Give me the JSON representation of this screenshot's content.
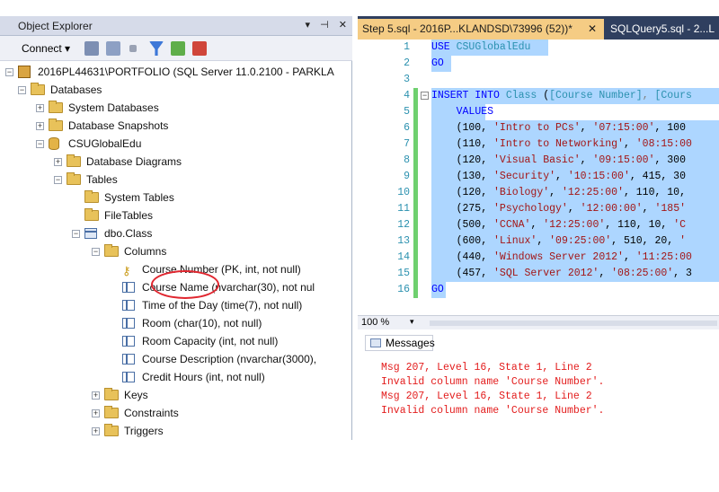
{
  "object_explorer": {
    "title": "Object Explorer",
    "title_buttons": [
      "▾",
      "⊣",
      "✕"
    ],
    "toolbar": {
      "connect_label": "Connect ▾"
    },
    "tree": [
      {
        "label": "2016PL44631\\PORTFOLIO (SQL Server 11.0.2100 - PARKLA",
        "icon": "server-icon",
        "expander": "-"
      },
      {
        "label": "Databases",
        "icon": "folder-icon",
        "expander": "-"
      },
      {
        "label": "System Databases",
        "icon": "folder-icon",
        "expander": "+"
      },
      {
        "label": "Database Snapshots",
        "icon": "folder-icon",
        "expander": "+"
      },
      {
        "label": "CSUGlobalEdu",
        "icon": "database-icon",
        "expander": "-"
      },
      {
        "label": "Database Diagrams",
        "icon": "folder-icon",
        "expander": "+"
      },
      {
        "label": "Tables",
        "icon": "folder-icon",
        "expander": "-"
      },
      {
        "label": "System Tables",
        "icon": "folder-icon",
        "expander": ""
      },
      {
        "label": "FileTables",
        "icon": "folder-icon",
        "expander": ""
      },
      {
        "label": "dbo.Class",
        "icon": "table-icon",
        "expander": "-"
      },
      {
        "label": "Columns",
        "icon": "folder-icon",
        "expander": "-"
      },
      {
        "label": "Course Number (PK, int, not null)",
        "icon": "key-icon",
        "expander": ""
      },
      {
        "label": "Course Name (nvarchar(30), not nul",
        "icon": "column-icon",
        "expander": ""
      },
      {
        "label": "Time of the Day (time(7), not null)",
        "icon": "column-icon",
        "expander": ""
      },
      {
        "label": "Room (char(10), not null)",
        "icon": "column-icon",
        "expander": ""
      },
      {
        "label": "Room Capacity (int, not null)",
        "icon": "column-icon",
        "expander": ""
      },
      {
        "label": "Course Description (nvarchar(3000),",
        "icon": "column-icon",
        "expander": ""
      },
      {
        "label": "Credit Hours (int, not null)",
        "icon": "column-icon",
        "expander": ""
      },
      {
        "label": "Keys",
        "icon": "folder-icon",
        "expander": "+"
      },
      {
        "label": "Constraints",
        "icon": "folder-icon",
        "expander": "+"
      },
      {
        "label": "Triggers",
        "icon": "folder-icon",
        "expander": "+"
      }
    ]
  },
  "editor": {
    "tabs": [
      {
        "label": "Step 5.sql - 2016P...KLANDSD\\73996 (52))*",
        "close": "✕",
        "active": true
      },
      {
        "label": "SQLQuery5.sql - 2...L",
        "active": false
      }
    ],
    "code_lines": [
      {
        "n": "1",
        "parts": [
          [
            "kw",
            "USE"
          ],
          [
            "",
            " "
          ],
          [
            "tbl",
            "CSUGlobalEdu"
          ]
        ]
      },
      {
        "n": "2",
        "parts": [
          [
            "kw",
            "GO"
          ]
        ]
      },
      {
        "n": "3",
        "parts": []
      },
      {
        "n": "4",
        "parts": [
          [
            "kw",
            "INSERT INTO"
          ],
          [
            "",
            " "
          ],
          [
            "tbl",
            "Class"
          ],
          [
            "",
            " ("
          ],
          [
            "tbl",
            "[Course Number]"
          ],
          [
            "gr",
            ", "
          ],
          [
            "tbl",
            "[Cours"
          ]
        ]
      },
      {
        "n": "5",
        "parts": [
          [
            "",
            "    "
          ],
          [
            "kw",
            "VALUES"
          ]
        ]
      },
      {
        "n": "6",
        "parts": [
          [
            "",
            "    (100, "
          ],
          [
            "str",
            "'Intro to PCs'"
          ],
          [
            "",
            ", "
          ],
          [
            "str",
            "'07:15:00'"
          ],
          [
            "",
            ", 100"
          ]
        ]
      },
      {
        "n": "7",
        "parts": [
          [
            "",
            "    (110, "
          ],
          [
            "str",
            "'Intro to Networking'"
          ],
          [
            "",
            ", "
          ],
          [
            "str",
            "'08:15:00"
          ]
        ]
      },
      {
        "n": "8",
        "parts": [
          [
            "",
            "    (120, "
          ],
          [
            "str",
            "'Visual Basic'"
          ],
          [
            "",
            ", "
          ],
          [
            "str",
            "'09:15:00'"
          ],
          [
            "",
            ", 300"
          ]
        ]
      },
      {
        "n": "9",
        "parts": [
          [
            "",
            "    (130, "
          ],
          [
            "str",
            "'Security'"
          ],
          [
            "",
            ", "
          ],
          [
            "str",
            "'10:15:00'"
          ],
          [
            "",
            ", 415, 30"
          ]
        ]
      },
      {
        "n": "10",
        "parts": [
          [
            "",
            "    (120, "
          ],
          [
            "str",
            "'Biology'"
          ],
          [
            "",
            ", "
          ],
          [
            "str",
            "'12:25:00'"
          ],
          [
            "",
            ", 110, 10,"
          ]
        ]
      },
      {
        "n": "11",
        "parts": [
          [
            "",
            "    (275, "
          ],
          [
            "str",
            "'Psychology'"
          ],
          [
            "",
            ", "
          ],
          [
            "str",
            "'12:00:00'"
          ],
          [
            "",
            ", "
          ],
          [
            "str",
            "'185'"
          ]
        ]
      },
      {
        "n": "12",
        "parts": [
          [
            "",
            "    (500, "
          ],
          [
            "str",
            "'CCNA'"
          ],
          [
            "",
            ", "
          ],
          [
            "str",
            "'12:25:00'"
          ],
          [
            "",
            ", 110, 10, "
          ],
          [
            "str",
            "'C"
          ]
        ]
      },
      {
        "n": "13",
        "parts": [
          [
            "",
            "    (600, "
          ],
          [
            "str",
            "'Linux'"
          ],
          [
            "",
            ", "
          ],
          [
            "str",
            "'09:25:00'"
          ],
          [
            "",
            ", 510, 20, "
          ],
          [
            "str",
            "'"
          ]
        ]
      },
      {
        "n": "14",
        "parts": [
          [
            "",
            "    (440, "
          ],
          [
            "str",
            "'Windows Server 2012'"
          ],
          [
            "",
            ", "
          ],
          [
            "str",
            "'11:25:00"
          ]
        ]
      },
      {
        "n": "15",
        "parts": [
          [
            "",
            "    (457, "
          ],
          [
            "str",
            "'SQL Server 2012'"
          ],
          [
            "",
            ", "
          ],
          [
            "str",
            "'08:25:00'"
          ],
          [
            "",
            ", 3"
          ]
        ]
      },
      {
        "n": "16",
        "parts": [
          [
            "kw",
            "GO"
          ]
        ]
      }
    ],
    "zoom": "100 %",
    "zoom_dropdown": "▾"
  },
  "results": {
    "tab_label": "Messages",
    "messages": [
      "Msg 207, Level 16, State 1, Line 2",
      "Invalid column name 'Course Number'.",
      "Msg 207, Level 16, State 1, Line 2",
      "Invalid column name 'Course Number'."
    ]
  },
  "colors": {
    "keyword": "#0000ff",
    "identifier": "#2b91af",
    "string": "#a31515",
    "error": "#e31c1c",
    "selection": "#add6ff",
    "active_tab": "#f5cc84",
    "tab_strip": "#2f3f5f"
  }
}
